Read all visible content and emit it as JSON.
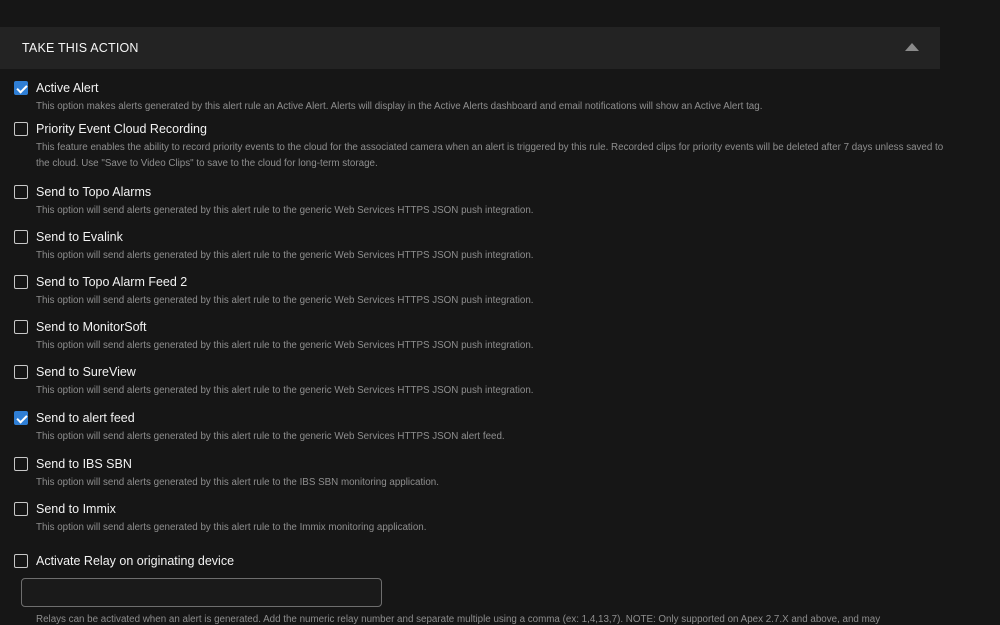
{
  "section": {
    "title": "TAKE THIS ACTION",
    "collapse_icon": "chevron-up-icon"
  },
  "options": [
    {
      "label": "Active Alert",
      "checked": true,
      "description": "This option makes alerts generated by this alert rule an Active Alert. Alerts will display in the Active Alerts dashboard and email notifications will show an Active Alert tag."
    },
    {
      "label": "Priority Event Cloud Recording",
      "checked": false,
      "description": "This feature enables the ability to record priority events to the cloud for the associated camera when an alert is triggered by this rule. Recorded clips for priority events will be deleted after 7 days unless saved to the cloud. Use \"Save to Video Clips\" to save to the cloud for long-term storage."
    },
    {
      "label": "Send to Topo Alarms",
      "checked": false,
      "description": "This option will send alerts generated by this alert rule to the generic Web Services HTTPS JSON push integration."
    },
    {
      "label": "Send to Evalink",
      "checked": false,
      "description": "This option will send alerts generated by this alert rule to the generic Web Services HTTPS JSON push integration."
    },
    {
      "label": "Send to Topo Alarm Feed 2",
      "checked": false,
      "description": "This option will send alerts generated by this alert rule to the generic Web Services HTTPS JSON push integration."
    },
    {
      "label": "Send to MonitorSoft",
      "checked": false,
      "description": "This option will send alerts generated by this alert rule to the generic Web Services HTTPS JSON push integration."
    },
    {
      "label": "Send to SureView",
      "checked": false,
      "description": "This option will send alerts generated by this alert rule to the generic Web Services HTTPS JSON push integration."
    },
    {
      "label": "Send to alert feed",
      "checked": true,
      "description": "This option will send alerts generated by this alert rule to the generic Web Services HTTPS JSON alert feed."
    },
    {
      "label": "Send to IBS SBN",
      "checked": false,
      "description": "This option will send alerts generated by this alert rule to the IBS SBN monitoring application."
    },
    {
      "label": "Send to Immix",
      "checked": false,
      "description": "This option will send alerts generated by this alert rule to the Immix monitoring application."
    },
    {
      "label": "Activate Relay on originating device",
      "checked": false,
      "description": ""
    }
  ],
  "relay": {
    "value": "",
    "placeholder": "",
    "help": "Relays can be activated when an alert is generated. Add the numeric relay number and separate multiple using a comma (ex: 1,4,13,7). NOTE: Only supported on Apex 2.7.X and above, and may"
  },
  "colors": {
    "background": "#161616",
    "header_background": "#232323",
    "checkbox_checked": "#2f7fd6",
    "description_text": "#8e8e8e"
  }
}
